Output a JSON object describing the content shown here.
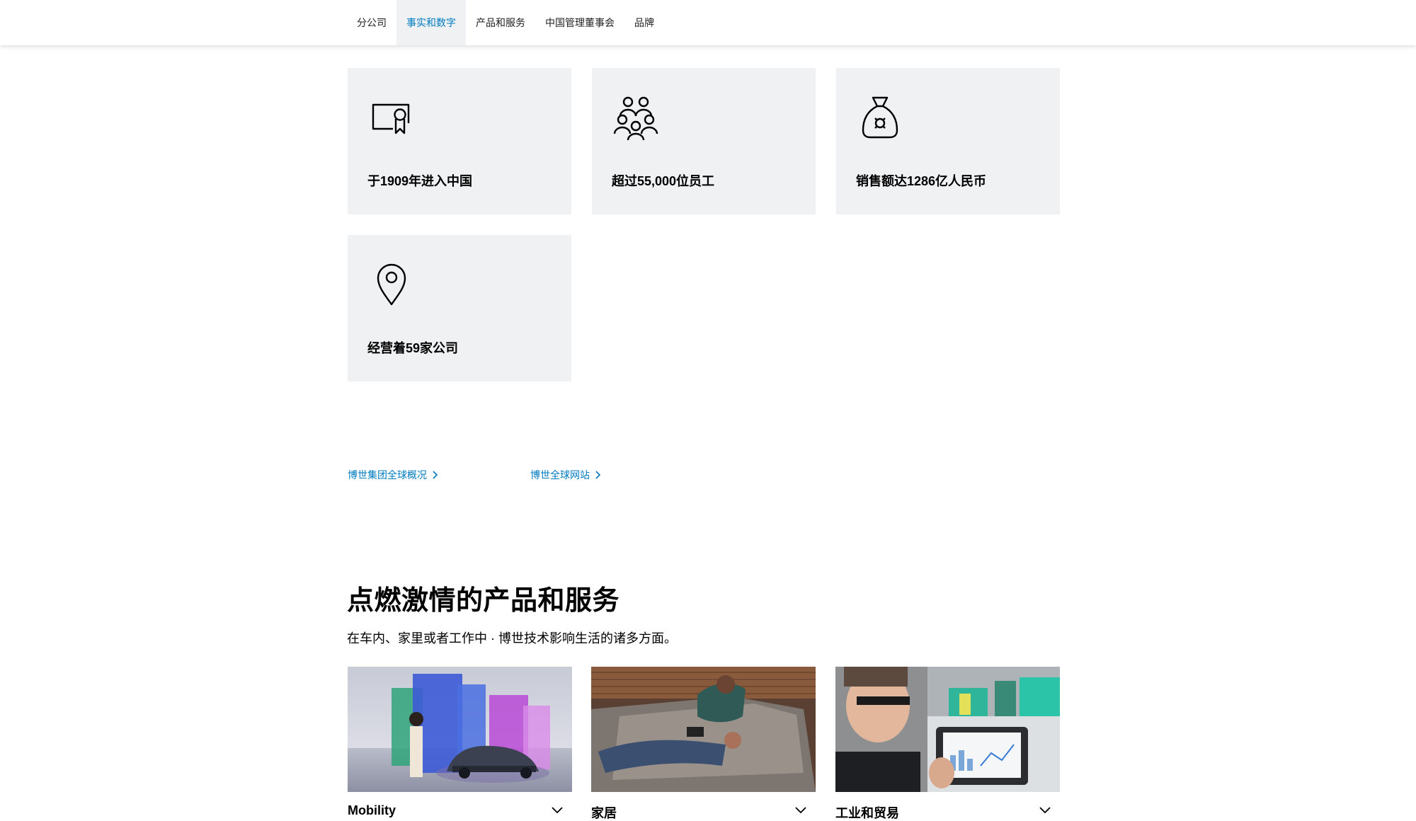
{
  "nav": {
    "tabs": [
      {
        "label": "分公司",
        "active": false
      },
      {
        "label": "事实和数字",
        "active": true
      },
      {
        "label": "产品和服务",
        "active": false
      },
      {
        "label": "中国管理董事会",
        "active": false
      },
      {
        "label": "品牌",
        "active": false
      }
    ]
  },
  "facts": [
    {
      "icon": "certificate-icon",
      "label": "于1909年进入中国"
    },
    {
      "icon": "people-group-icon",
      "label": "超过55,000位员工"
    },
    {
      "icon": "money-bag-icon",
      "label": "销售额达1286亿人民币"
    },
    {
      "icon": "location-pin-icon",
      "label": "经营着59家公司"
    }
  ],
  "links": [
    {
      "label": "博世集团全球概况",
      "icon": "chevron-right-icon"
    },
    {
      "label": "博世全球网站",
      "icon": "chevron-right-icon"
    }
  ],
  "products": {
    "title": "点燃激情的产品和服务",
    "subtitle": "在车内、家里或者工作中 · 博世技术影响生活的诸多方面。",
    "items": [
      {
        "label": "Mobility",
        "icon": "chevron-down-icon"
      },
      {
        "label": "家居",
        "icon": "chevron-down-icon"
      },
      {
        "label": "工业和贸易",
        "icon": "chevron-down-icon"
      }
    ]
  },
  "colors": {
    "accent": "#007bc0",
    "card_bg": "#eff1f2",
    "text": "#000000"
  }
}
